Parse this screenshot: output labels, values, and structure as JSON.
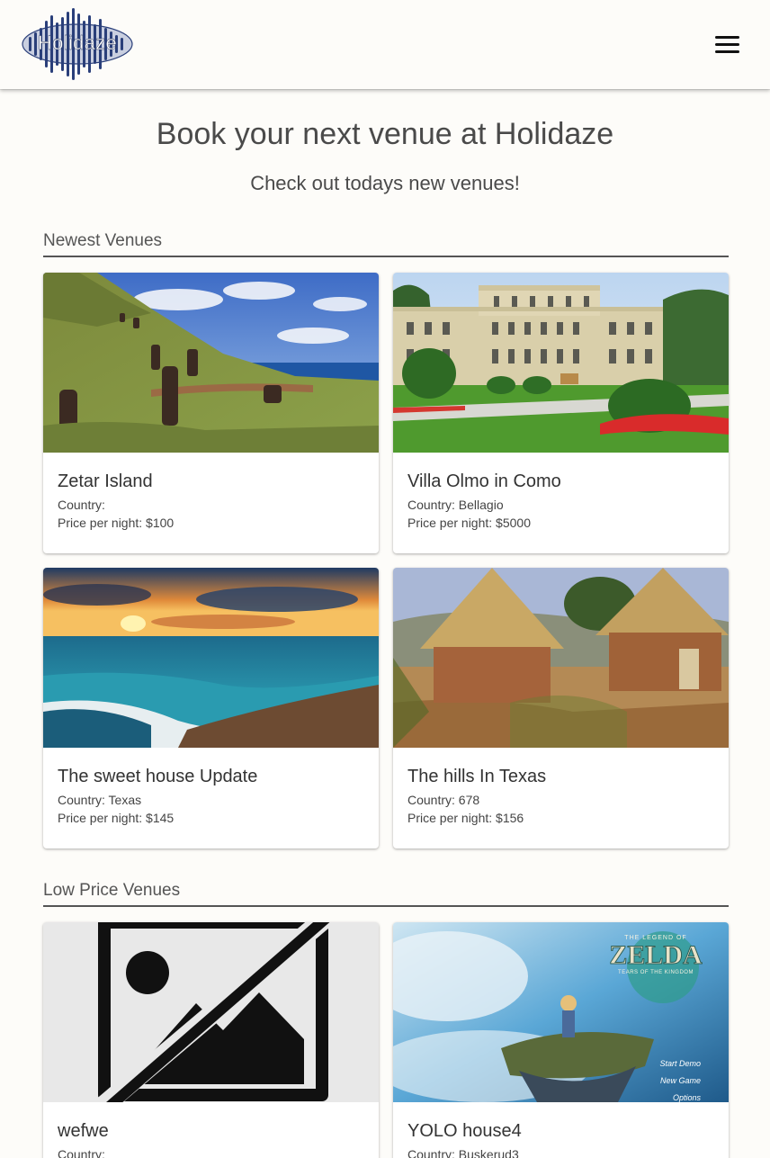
{
  "brand": {
    "logo_text": "Holidaze"
  },
  "nav": {
    "menu_icon": "hamburger-menu-icon"
  },
  "hero": {
    "title": "Book your next venue at Holidaze",
    "subtitle": "Check out todays new venues!"
  },
  "sections": {
    "newest": {
      "title": "Newest Venues",
      "venues": [
        {
          "name": "Zetar Island",
          "country": "Country: ",
          "price": "Price per night: $100"
        },
        {
          "name": "Villa Olmo in Como",
          "country": "Country: Bellagio",
          "price": "Price per night: $5000"
        },
        {
          "name": "The sweet house Update",
          "country": "Country: Texas",
          "price": "Price per night: $145"
        },
        {
          "name": "The hills In Texas",
          "country": "Country: 678",
          "price": "Price per night: $156"
        }
      ]
    },
    "low_price": {
      "title": "Low Price Venues",
      "venues": [
        {
          "name": "wefwe",
          "country": "Country: ",
          "price": ""
        },
        {
          "name": "YOLO house4",
          "country": "Country: Buskerud3",
          "price": ""
        }
      ]
    }
  },
  "zelda_art": {
    "logo_top": "THE LEGEND OF",
    "logo_main": "ZELDA",
    "logo_sub": "TEARS OF THE KINGDOM",
    "menu": [
      "Start Demo",
      "New Game",
      "Options"
    ]
  },
  "colors": {
    "background": "#fdfcf9",
    "text": "#333333",
    "divider": "#555555",
    "logo_blue": "#2a3f7a"
  }
}
